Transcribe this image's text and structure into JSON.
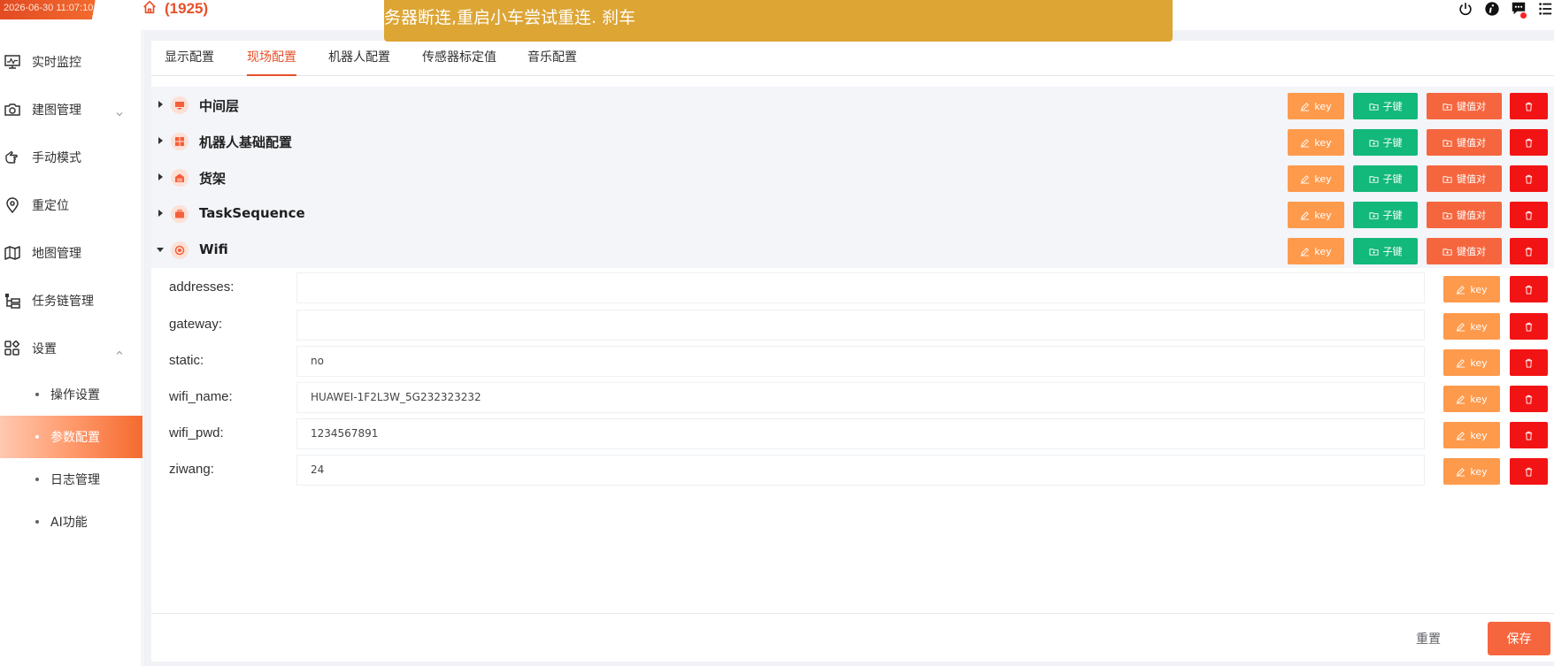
{
  "header": {
    "clock": "2026-06-30 11:07:10",
    "robot_id": "(1925)",
    "notice": "务器断连,重启小车尝试重连.  刹车",
    "icons": [
      "power-icon",
      "info-icon",
      "message-icon",
      "menu-icon"
    ]
  },
  "sidebar": {
    "items": [
      {
        "label": "实时监控",
        "icon": "monitor-icon"
      },
      {
        "label": "建图管理",
        "icon": "camera-icon"
      },
      {
        "label": "手动模式",
        "icon": "hand-icon"
      },
      {
        "label": "重定位",
        "icon": "location-icon"
      },
      {
        "label": "地图管理",
        "icon": "map-icon"
      },
      {
        "label": "任务链管理",
        "icon": "task-chain-icon"
      },
      {
        "label": "设置",
        "icon": "settings-grid-icon"
      }
    ],
    "sub_items": [
      {
        "label": "操作设置"
      },
      {
        "label": "参数配置"
      },
      {
        "label": "日志管理"
      },
      {
        "label": "AI功能"
      }
    ]
  },
  "tabs": [
    "显示配置",
    "现场配置",
    "机器人配置",
    "传感器标定值",
    "音乐配置"
  ],
  "buttons": {
    "key": "key",
    "child": "子键",
    "kv": "键值对"
  },
  "groups": [
    {
      "label": "中间层",
      "expanded": false
    },
    {
      "label": "机器人基础配置",
      "expanded": false
    },
    {
      "label": "货架",
      "expanded": false
    },
    {
      "label": "TaskSequence",
      "expanded": false
    },
    {
      "label": "Wifi",
      "expanded": true
    }
  ],
  "wifi_entries": [
    {
      "key": "addresses:",
      "value": ""
    },
    {
      "key": "gateway:",
      "value": ""
    },
    {
      "key": "static:",
      "value": "no"
    },
    {
      "key": "wifi_name:",
      "value": "HUAWEI-1F2L3W_5G232323232"
    },
    {
      "key": "wifi_pwd:",
      "value": "1234567891"
    },
    {
      "key": "ziwang:",
      "value": "24"
    }
  ],
  "footer": {
    "reset": "重置",
    "save": "保存"
  },
  "colors": {
    "brand": "#e8502a",
    "key_button": "#fe9a4c",
    "child_button": "#13b87b",
    "kv_button": "#f6663e",
    "delete_button": "#f21414",
    "notice": "#dca534"
  }
}
